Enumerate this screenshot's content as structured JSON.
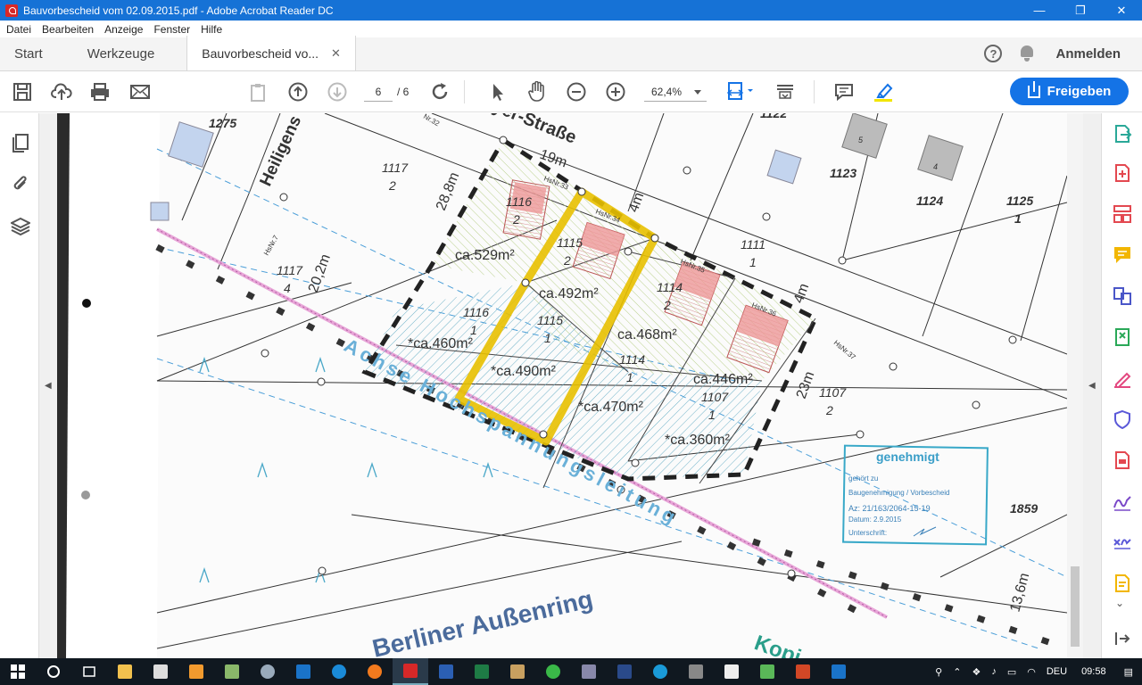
{
  "window": {
    "title": "Bauvorbescheid vom 02.09.2015.pdf - Adobe Acrobat Reader DC",
    "minimize": "—",
    "maximize": "❐",
    "close": "✕"
  },
  "menu": [
    "Datei",
    "Bearbeiten",
    "Anzeige",
    "Fenster",
    "Hilfe"
  ],
  "tabs": {
    "home": "Start",
    "tools": "Werkzeuge",
    "document": "Bauvorbescheid vo...",
    "close": "✕"
  },
  "account": {
    "help": "?",
    "signin": "Anmelden"
  },
  "toolbar": {
    "page_current": "6",
    "page_total": "/ 6",
    "zoom": "62,4%",
    "share_label": "Freigeben"
  },
  "map": {
    "street_top": "yer-Straße",
    "street_left": "Heiligens",
    "street_bottom": "Berliner Außenring",
    "street_partial": "Kopi",
    "power_line": "Achse Hochspannungsleitung",
    "parcels": {
      "p1275": "1275",
      "p1122": "1122",
      "p1123": "1123",
      "p1124": "1124",
      "p1125": "1125",
      "p1125d": "1",
      "p1117a": "1117",
      "p1117a_d": "2",
      "p1117b": "1117",
      "p1117b_d": "4",
      "p1116a": "1116",
      "p1116a_d": "2",
      "p1115a": "1115",
      "p1115a_d": "2",
      "p1114a": "1114",
      "p1114a_d": "2",
      "p1111": "1111",
      "p1111_d": "1",
      "p1116b": "1116",
      "p1116b_d": "1",
      "p1115b": "1115",
      "p1115b_d": "1",
      "p1114b": "1114",
      "p1114b_d": "1",
      "p1107a": "1107",
      "p1107a_d": "1",
      "p1107b": "1107",
      "p1107b_d": "2",
      "p1859": "1859",
      "hs5": "5",
      "hs4": "4"
    },
    "house_numbers": {
      "hs33": "HsNr.33",
      "hs34": "HsNr.34",
      "hs35": "HsNr.35",
      "hs36": "HsNr.36",
      "hs37": "HsNr.37",
      "hs7": "HsNr.7",
      "hs32": "Nr.32"
    },
    "areas": {
      "a529": "ca.529m²",
      "a492": "ca.492m²",
      "a468": "ca.468m²",
      "a446": "ca.446m²",
      "a460": "*ca.460m²",
      "a490": "*ca.490m²",
      "a470": "*ca.470m²",
      "a360": "*ca.360m²"
    },
    "dimensions": {
      "d19": "19m",
      "d4a": "4m",
      "d4b": "4m",
      "d288": "28,8m",
      "d202": "20,2m",
      "d23": "23m",
      "d136": "13,6m"
    },
    "stamp": {
      "title": "genehmigt",
      "line1": "gehört zu",
      "line2": "Baugenehmigung / Vorbescheid",
      "az": "Az: 21/163/2064-15-19",
      "datum": "Datum: 2.9.2015",
      "unterschrift": "Unterschrift:"
    }
  },
  "taskbar": {
    "lang": "DEU",
    "time": "09:58"
  }
}
